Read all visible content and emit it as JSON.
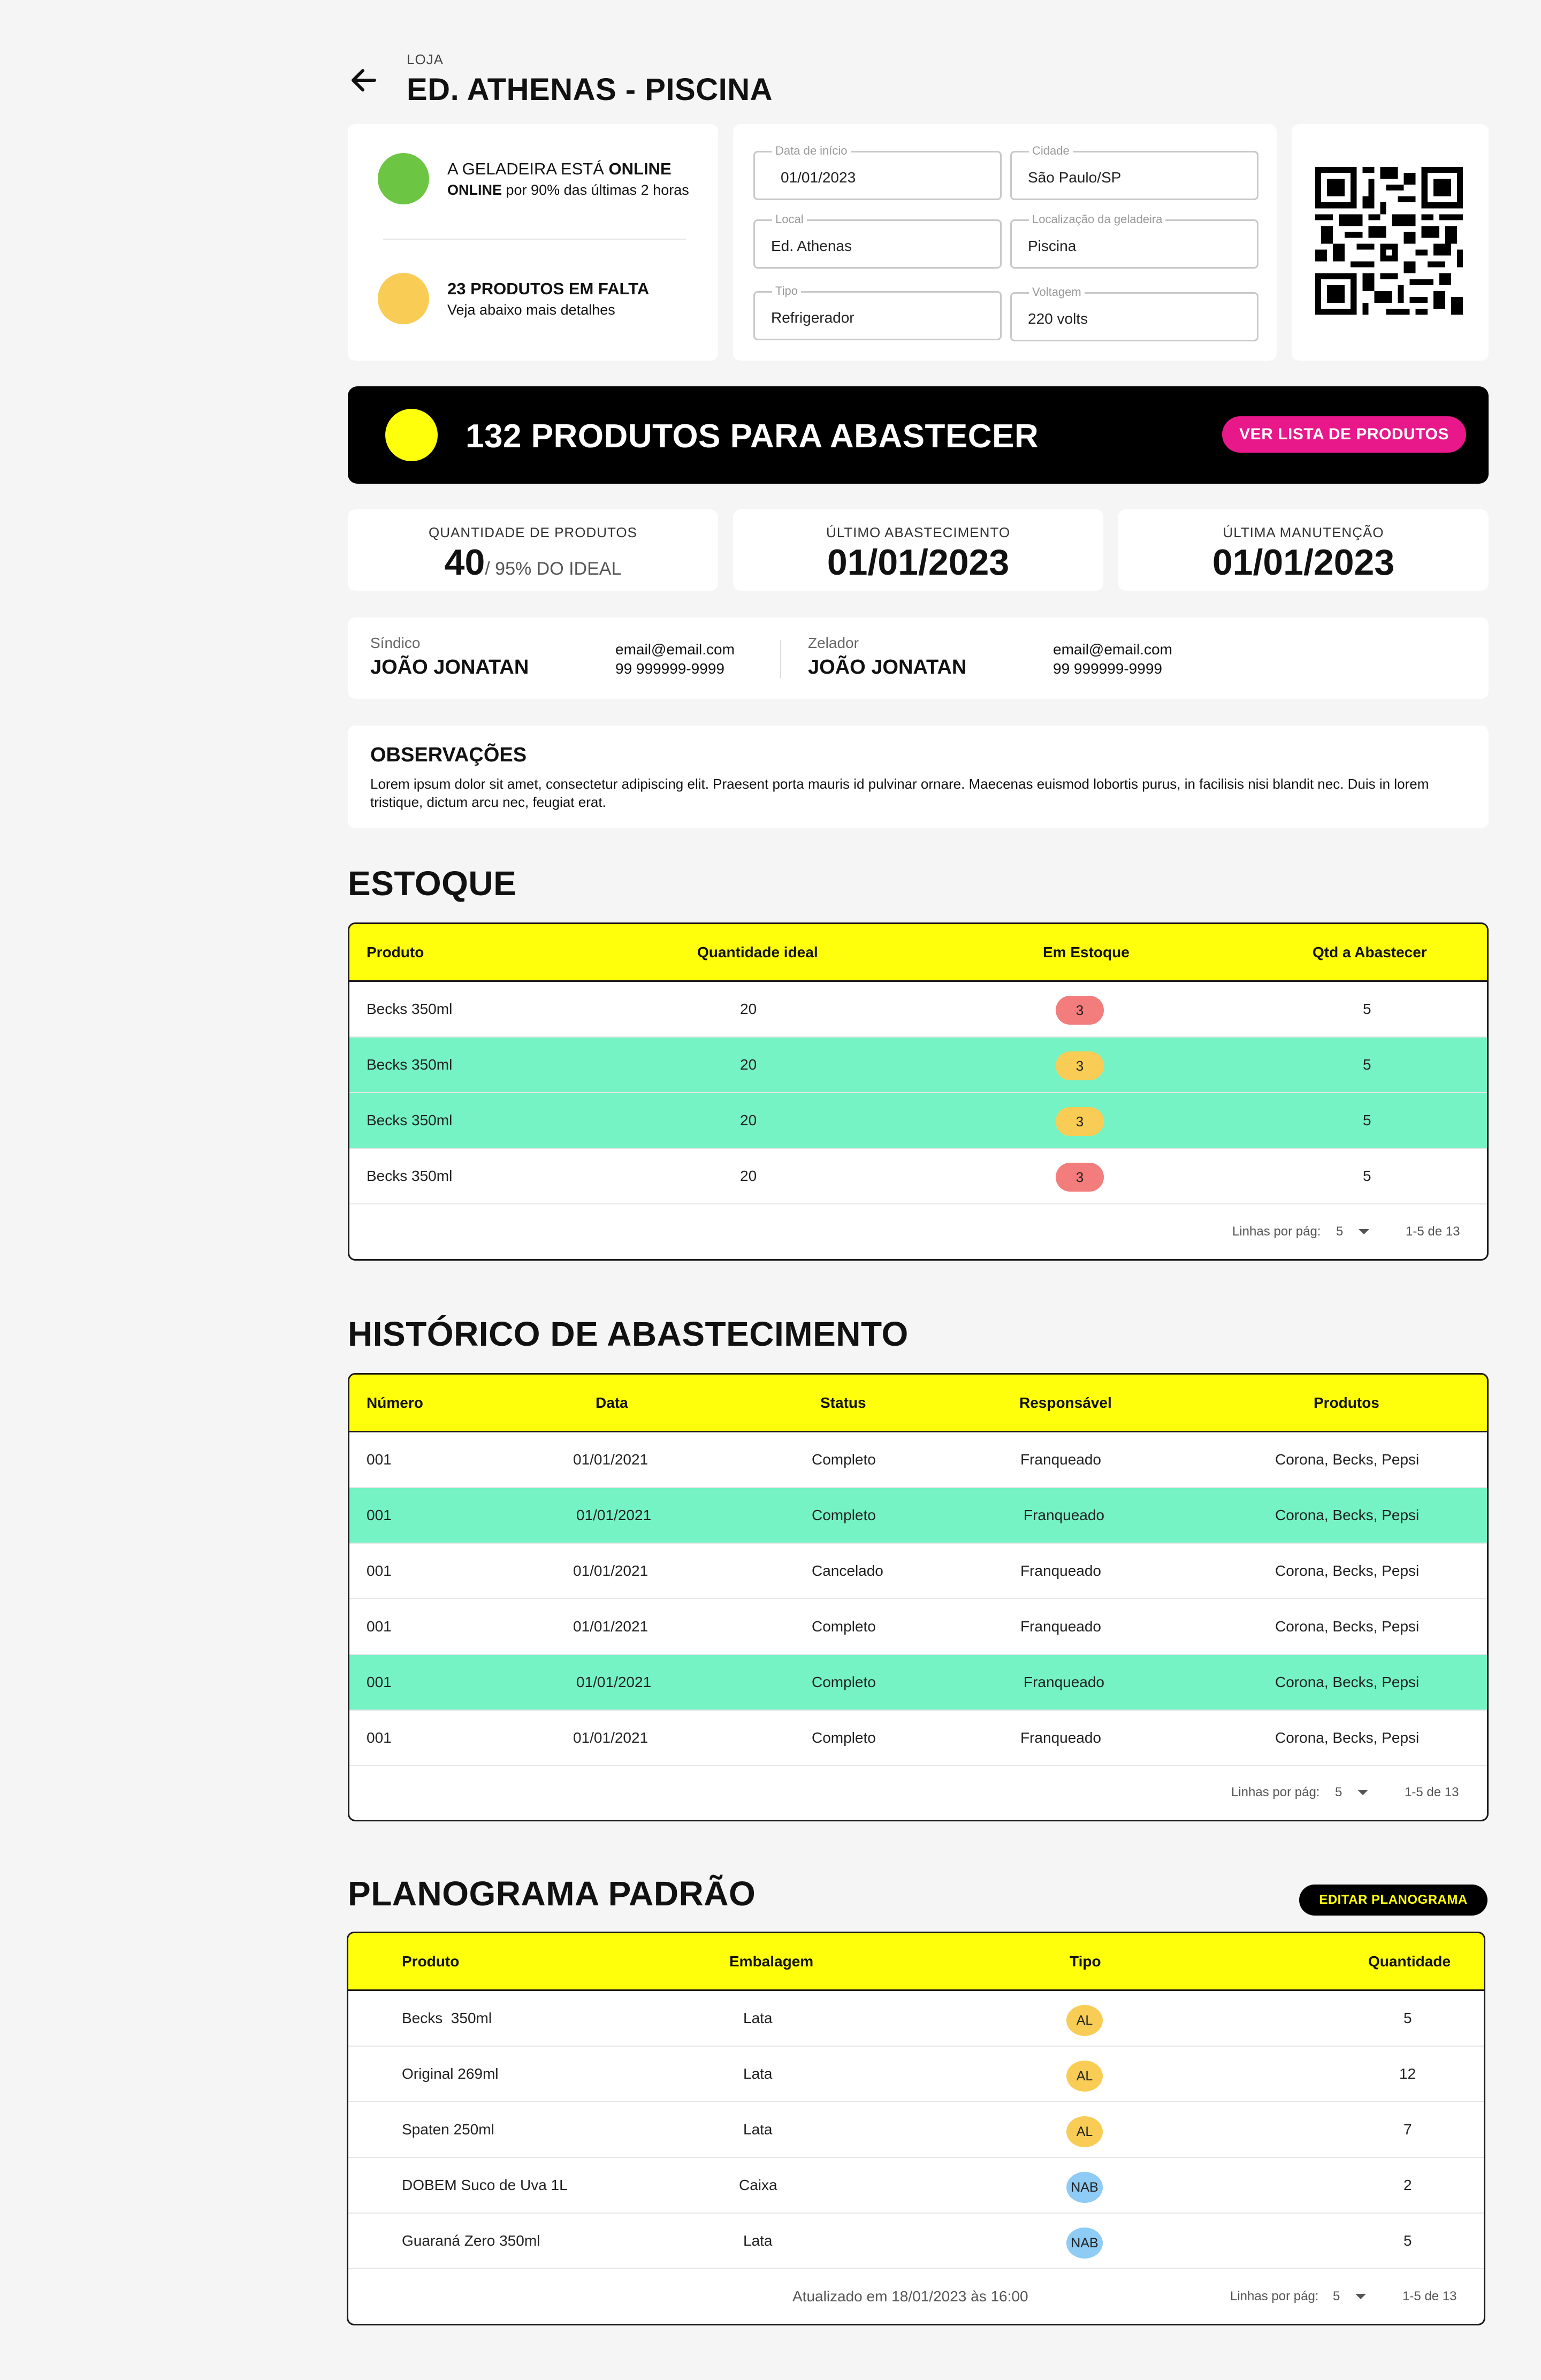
{
  "header": {
    "label": "LOJA",
    "title": "ED. ATHENAS - PISCINA",
    "back_icon": "arrow-left-icon"
  },
  "status": {
    "online_prefix": "A GELADEIRA ESTÁ",
    "online_word": "ONLINE",
    "online_detail_bold": "ONLINE",
    "online_detail": "por 90% das últimas 2 horas",
    "online_color": "#6cc644",
    "missing_title": "23 PRODUTOS EM FALTA",
    "missing_detail": "Veja abaixo mais detalhes",
    "missing_color": "#f9cd55"
  },
  "info": {
    "start_date": {
      "label": "Data de início",
      "value": "01/01/2023"
    },
    "city": {
      "label": "Cidade",
      "value": "São Paulo/SP"
    },
    "place": {
      "label": "Local",
      "value": "Ed. Athenas"
    },
    "location": {
      "label": "Localização da geladeira",
      "value": "Piscina"
    },
    "type": {
      "label": "Tipo",
      "value": "Refrigerador"
    },
    "voltage": {
      "label": "Voltagem",
      "value": "220 volts"
    }
  },
  "banner": {
    "text": "132 PRODUTOS PARA ABASTECER",
    "button": "VER LISTA DE PRODUTOS",
    "dot_color": "#ffff0b",
    "button_color": "#e8188a"
  },
  "stats": {
    "qty_label": "QUANTIDADE DE PRODUTOS",
    "qty_value": "40",
    "qty_sub": "/ 95% DO IDEAL",
    "last_supply_label": "ÚLTIMO ABASTECIMENTO",
    "last_supply_value": "01/01/2023",
    "last_maint_label": "ÚLTIMA MANUTENÇÃO",
    "last_maint_value": "01/01/2023"
  },
  "contacts": [
    {
      "role": "Síndico",
      "name": "JOÃO JONATAN",
      "email": "email@email.com",
      "phone": "99 999999-9999"
    },
    {
      "role": "Zelador",
      "name": "JOÃO JONATAN",
      "email": "email@email.com",
      "phone": "99 999999-9999"
    }
  ],
  "notes": {
    "title": "OBSERVAÇÕES",
    "text": "Lorem ipsum dolor sit amet, consectetur adipiscing elit. Praesent porta mauris id pulvinar ornare. Maecenas euismod lobortis purus, in facilisis nisi blandit nec. Duis in lorem tristique, dictum arcu nec, feugiat erat."
  },
  "stock": {
    "title": "ESTOQUE",
    "headers": [
      "Produto",
      "Quantidade ideal",
      "Em Estoque",
      "Qtd a Abastecer"
    ],
    "rows": [
      {
        "product": "Becks 350ml",
        "ideal": "20",
        "in_stock": "3",
        "to_supply": "5",
        "status_color": "#f37c7c",
        "highlight": false
      },
      {
        "product": "Becks 350ml",
        "ideal": "20",
        "in_stock": "3",
        "to_supply": "5",
        "status_color": "#f9cd55",
        "highlight": true
      },
      {
        "product": "Becks 350ml",
        "ideal": "20",
        "in_stock": "3",
        "to_supply": "5",
        "status_color": "#f9cd55",
        "highlight": true
      },
      {
        "product": "Becks 350ml",
        "ideal": "20",
        "in_stock": "3",
        "to_supply": "5",
        "status_color": "#f37c7c",
        "highlight": false
      }
    ],
    "rows_per_page_label": "Linhas por pág:",
    "rows_per_page": "5",
    "range": "1-5 de 13"
  },
  "history": {
    "title": "HISTÓRICO DE ABASTECIMENTO",
    "headers": [
      "Número",
      "Data",
      "Status",
      "Responsável",
      "Produtos"
    ],
    "rows": [
      {
        "number": "001",
        "date": "01/01/2021",
        "status": "Completo",
        "owner": "Franqueado",
        "products": "Corona, Becks, Pepsi",
        "highlight": false
      },
      {
        "number": "001",
        "date": "01/01/2021",
        "status": "Completo",
        "owner": "Franqueado",
        "products": "Corona, Becks, Pepsi",
        "highlight": true
      },
      {
        "number": "001",
        "date": "01/01/2021",
        "status": "Cancelado",
        "owner": "Franqueado",
        "products": "Corona, Becks, Pepsi",
        "highlight": false
      },
      {
        "number": "001",
        "date": "01/01/2021",
        "status": "Completo",
        "owner": "Franqueado",
        "products": "Corona, Becks, Pepsi",
        "highlight": false
      },
      {
        "number": "001",
        "date": "01/01/2021",
        "status": "Completo",
        "owner": "Franqueado",
        "products": "Corona, Becks, Pepsi",
        "highlight": true
      },
      {
        "number": "001",
        "date": "01/01/2021",
        "status": "Completo",
        "owner": "Franqueado",
        "products": "Corona, Becks, Pepsi",
        "highlight": false
      }
    ],
    "rows_per_page_label": "Linhas por pág:",
    "rows_per_page": "5",
    "range": "1-5 de 13"
  },
  "planogram": {
    "title": "PLANOGRAMA PADRÃO",
    "edit_button": "EDITAR PLANOGRAMA",
    "headers": [
      "Produto",
      "Embalagem",
      "Tipo",
      "Quantidade"
    ],
    "rows": [
      {
        "product": "Becks  350ml",
        "package": "Lata",
        "type": "AL",
        "qty": "5"
      },
      {
        "product": "Original 269ml",
        "package": "Lata",
        "type": "AL",
        "qty": "12"
      },
      {
        "product": "Spaten 250ml",
        "package": "Lata",
        "type": "AL",
        "qty": "7"
      },
      {
        "product": "DOBEM Suco de Uva 1L",
        "package": "Caixa",
        "type": "NAB",
        "qty": "2"
      },
      {
        "product": "Guaraná Zero 350ml",
        "package": "Lata",
        "type": "NAB",
        "qty": "5"
      }
    ],
    "updated": "Atualizado em 18/01/2023 às 16:00",
    "rows_per_page_label": "Linhas por pág:",
    "rows_per_page": "5",
    "range": "1-5 de 13"
  },
  "colors": {
    "accent_yellow": "#ffff0b",
    "row_highlight": "#75f3c4",
    "pink": "#e8188a"
  }
}
